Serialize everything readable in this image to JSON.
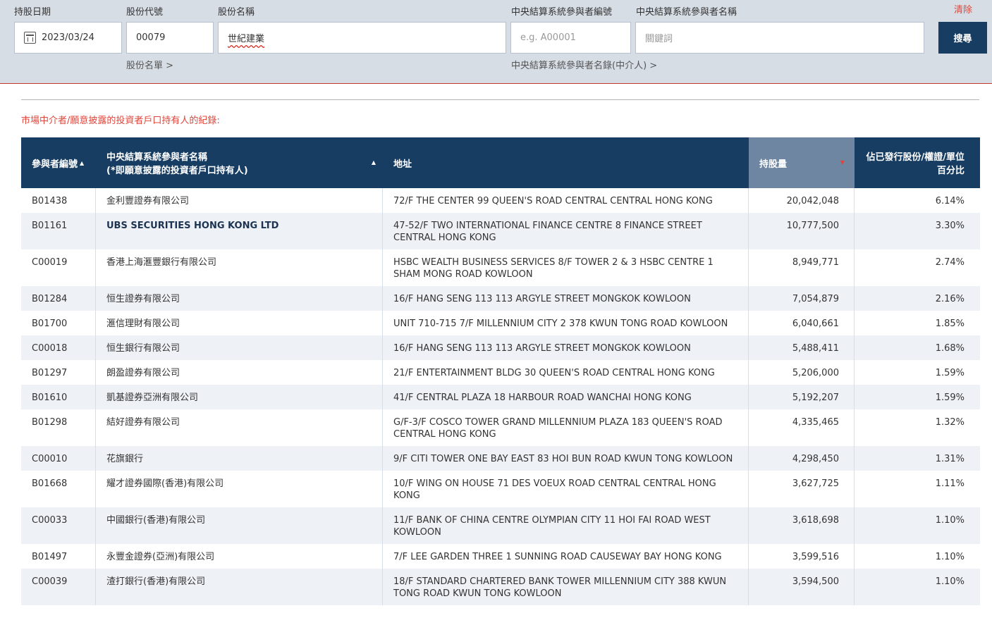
{
  "search": {
    "date_label": "持股日期",
    "date_value": "2023/03/24",
    "code_label": "股份代號",
    "code_value": "00079",
    "name_label": "股份名稱",
    "name_value": "世紀建業",
    "participant_id_label": "中央結算系統參與者編號",
    "participant_id_placeholder": "e.g. A00001",
    "participant_name_label": "中央結算系統參與者名稱",
    "participant_name_placeholder": "關鍵詞",
    "clear_label": "清除",
    "search_label": "搜尋",
    "stock_list_link": "股份名單 >",
    "participant_list_link": "中央結算系統參與者名錄(中介人) >"
  },
  "section_title": "市場中介者/願意披露的投資者戶口持有人的紀錄:",
  "table": {
    "headers": {
      "id": "參與者編號",
      "name_line1": "中央結算系統參與者名稱",
      "name_line2": "(*即願意披露的投資者戶口持有人)",
      "address": "地址",
      "shareholding": "持股量",
      "percent": "佔已發行股份/權證/單位百分比"
    },
    "rows": [
      {
        "id": "B01438",
        "name": "金利豐證券有限公司",
        "address": "72/F THE CENTER 99 QUEEN'S ROAD CENTRAL CENTRAL HONG KONG",
        "shareholding": "20,042,048",
        "percent": "6.14%"
      },
      {
        "id": "B01161",
        "name": "UBS SECURITIES HONG KONG LTD",
        "address": "47-52/F TWO INTERNATIONAL FINANCE CENTRE 8 FINANCE STREET CENTRAL HONG KONG",
        "shareholding": "10,777,500",
        "percent": "3.30%"
      },
      {
        "id": "C00019",
        "name": "香港上海滙豐銀行有限公司",
        "address": "HSBC WEALTH BUSINESS SERVICES 8/F TOWER 2 & 3 HSBC CENTRE 1 SHAM MONG ROAD KOWLOON",
        "shareholding": "8,949,771",
        "percent": "2.74%"
      },
      {
        "id": "B01284",
        "name": "恒生證券有限公司",
        "address": "16/F HANG SENG 113 113 ARGYLE STREET MONGKOK KOWLOON",
        "shareholding": "7,054,879",
        "percent": "2.16%"
      },
      {
        "id": "B01700",
        "name": "滙信理財有限公司",
        "address": "UNIT 710-715 7/F MILLENNIUM CITY 2 378 KWUN TONG ROAD KOWLOON",
        "shareholding": "6,040,661",
        "percent": "1.85%"
      },
      {
        "id": "C00018",
        "name": "恒生銀行有限公司",
        "address": "16/F HANG SENG 113 113 ARGYLE STREET MONGKOK KOWLOON",
        "shareholding": "5,488,411",
        "percent": "1.68%"
      },
      {
        "id": "B01297",
        "name": "朗盈證券有限公司",
        "address": "21/F ENTERTAINMENT BLDG 30 QUEEN'S ROAD CENTRAL HONG KONG",
        "shareholding": "5,206,000",
        "percent": "1.59%"
      },
      {
        "id": "B01610",
        "name": "凱基證券亞洲有限公司",
        "address": "41/F CENTRAL PLAZA 18 HARBOUR ROAD WANCHAI HONG KONG",
        "shareholding": "5,192,207",
        "percent": "1.59%"
      },
      {
        "id": "B01298",
        "name": "結好證券有限公司",
        "address": "G/F-3/F COSCO TOWER GRAND MILLENNIUM PLAZA 183 QUEEN'S ROAD CENTRAL HONG KONG",
        "shareholding": "4,335,465",
        "percent": "1.32%"
      },
      {
        "id": "C00010",
        "name": "花旗銀行",
        "address": "9/F CITI TOWER ONE BAY EAST 83 HOI BUN ROAD KWUN TONG KOWLOON",
        "shareholding": "4,298,450",
        "percent": "1.31%"
      },
      {
        "id": "B01668",
        "name": "耀才證券國際(香港)有限公司",
        "address": "10/F WING ON HOUSE 71 DES VOEUX ROAD CENTRAL CENTRAL HONG KONG",
        "shareholding": "3,627,725",
        "percent": "1.11%"
      },
      {
        "id": "C00033",
        "name": "中國銀行(香港)有限公司",
        "address": "11/F BANK OF CHINA CENTRE OLYMPIAN CITY 11 HOI FAI ROAD WEST KOWLOON",
        "shareholding": "3,618,698",
        "percent": "1.10%"
      },
      {
        "id": "B01497",
        "name": "永豐金證券(亞洲)有限公司",
        "address": "7/F LEE GARDEN THREE 1 SUNNING ROAD CAUSEWAY BAY HONG KONG",
        "shareholding": "3,599,516",
        "percent": "1.10%"
      },
      {
        "id": "C00039",
        "name": "渣打銀行(香港)有限公司",
        "address": "18/F STANDARD CHARTERED BANK TOWER MILLENNIUM CITY 388 KWUN TONG ROAD KWUN TONG KOWLOON",
        "shareholding": "3,594,500",
        "percent": "1.10%"
      }
    ]
  }
}
